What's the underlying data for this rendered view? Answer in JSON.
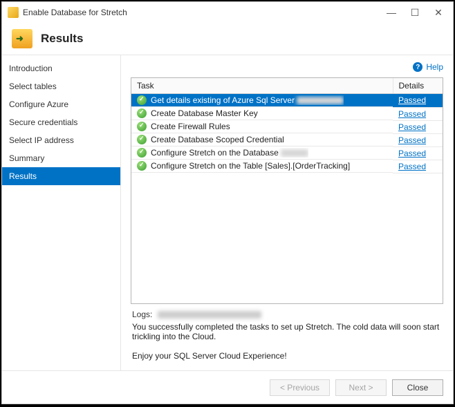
{
  "window": {
    "title": "Enable Database for Stretch"
  },
  "header": {
    "title": "Results"
  },
  "help": {
    "label": "Help"
  },
  "sidebar": {
    "items": [
      {
        "label": "Introduction"
      },
      {
        "label": "Select tables"
      },
      {
        "label": "Configure Azure"
      },
      {
        "label": "Secure credentials"
      },
      {
        "label": "Select IP address"
      },
      {
        "label": "Summary"
      },
      {
        "label": "Results"
      }
    ],
    "selected_index": 6
  },
  "table": {
    "headers": {
      "task": "Task",
      "details": "Details"
    },
    "rows": [
      {
        "task": "Get details existing of Azure Sql Server",
        "details": "Passed",
        "redacted": true,
        "selected": true
      },
      {
        "task": "Create Database Master Key",
        "details": "Passed"
      },
      {
        "task": "Create Firewall Rules",
        "details": "Passed"
      },
      {
        "task": "Create Database Scoped Credential",
        "details": "Passed"
      },
      {
        "task": "Configure Stretch on the Database",
        "details": "Passed",
        "redacted_small": true
      },
      {
        "task": "Configure Stretch on the Table [Sales].[OrderTracking]",
        "details": "Passed"
      }
    ]
  },
  "logs": {
    "label": "Logs:"
  },
  "messages": {
    "line1": "You successfully completed the tasks to set up Stretch. The cold data will soon start trickling into the Cloud.",
    "line2": "Enjoy your SQL Server Cloud Experience!"
  },
  "footer": {
    "previous": "< Previous",
    "next": "Next >",
    "close": "Close"
  }
}
